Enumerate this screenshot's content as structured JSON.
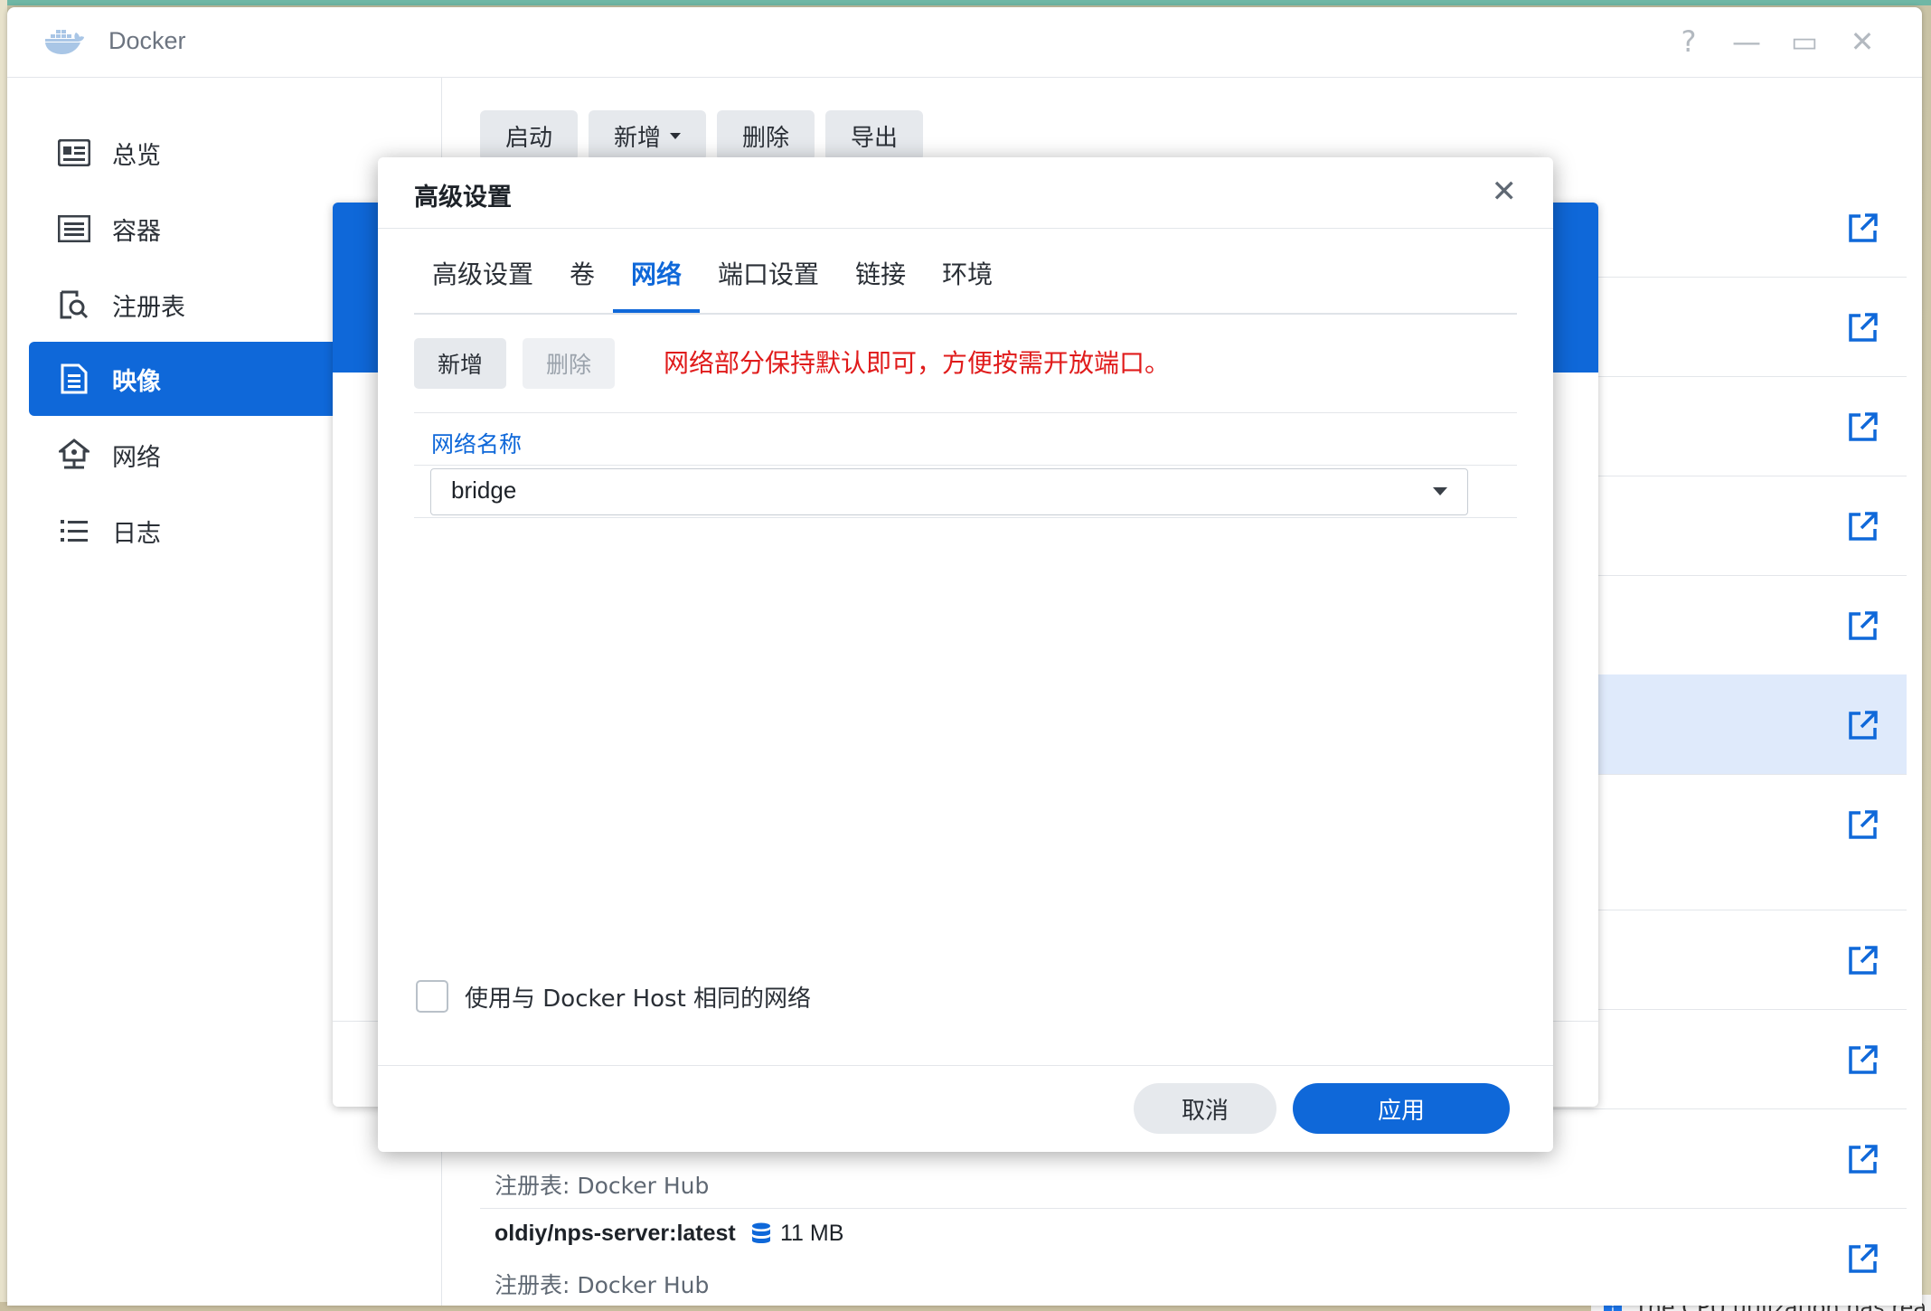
{
  "window": {
    "title": "Docker"
  },
  "window_controls": {
    "help": "?",
    "minimize": "—",
    "maximize": "▭",
    "close": "✕"
  },
  "sidebar": {
    "items": [
      {
        "label": "总览",
        "icon": "overview-icon"
      },
      {
        "label": "容器",
        "icon": "container-icon"
      },
      {
        "label": "注册表",
        "icon": "registry-icon"
      },
      {
        "label": "映像",
        "icon": "image-icon",
        "active": true
      },
      {
        "label": "网络",
        "icon": "network-icon"
      },
      {
        "label": "日志",
        "icon": "log-icon"
      }
    ]
  },
  "toolbar": {
    "launch": "启动",
    "add": "新增",
    "delete": "删除",
    "export": "导出"
  },
  "image_list": {
    "rows": [
      {
        "registry": "注册表: Docker Hub"
      },
      {
        "name": "oldiy/nps-server:latest",
        "size": "11 MB",
        "registry": "注册表: Docker Hub"
      }
    ]
  },
  "dialog": {
    "title": "高级设置",
    "close": "✕",
    "tabs": [
      "高级设置",
      "卷",
      "网络",
      "端口设置",
      "链接",
      "环境"
    ],
    "active_tab": "网络",
    "add_button": "新增",
    "delete_button": "删除",
    "note": "网络部分保持默认即可，方便按需开放端口。",
    "column_header": "网络名称",
    "network_value": "bridge",
    "checkbox_label": "使用与 Docker Host 相同的网络",
    "checkbox_checked": false,
    "cancel": "取消",
    "apply": "应用"
  },
  "notification": {
    "text": "The CPU utilization has rea"
  },
  "colors": {
    "accent": "#0f68d9",
    "note": "#e01b1b"
  }
}
